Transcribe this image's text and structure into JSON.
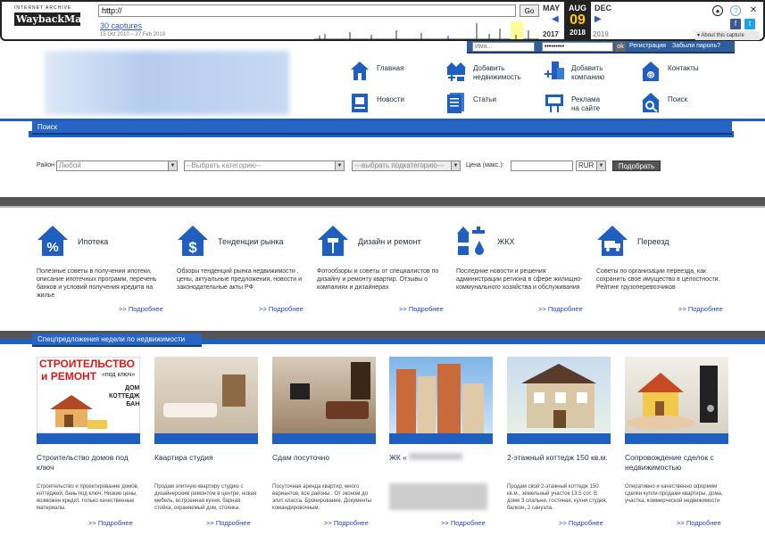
{
  "wayback": {
    "logo_top": "INTERNET ARCHIVE",
    "logo_main": "WaybackMachine",
    "url_value": "http://",
    "go_label": "Go",
    "captures_link": "30 captures",
    "range": "15 Oct 2010 – 27 Feb 2019",
    "prev_month": "MAY",
    "cur_month": "AUG",
    "next_month": "DEC",
    "cur_day": "09",
    "prev_year": "2017",
    "cur_year": "2018",
    "next_year": "2019",
    "about_label": "About this capture",
    "icons": [
      "user-icon",
      "help-icon",
      "facebook-icon",
      "twitter-icon"
    ]
  },
  "login": {
    "name_placeholder": "Имя...",
    "password_value": "•••••••••",
    "ok_label": "ok",
    "register": "Регистрация",
    "forgot": "Забыли пароль?"
  },
  "nav": [
    {
      "label": "Главная",
      "icon": "home-icon"
    },
    {
      "label": "Добавить\nнедвижимость",
      "icon": "add-property-icon"
    },
    {
      "label": "Добавить\nкомпанию",
      "icon": "add-company-icon"
    },
    {
      "label": "Контакты",
      "icon": "contacts-icon"
    },
    {
      "label": "Новости",
      "icon": "news-icon"
    },
    {
      "label": "Статьи",
      "icon": "articles-icon"
    },
    {
      "label": "Реклама\nна сайте",
      "icon": "advertising-icon"
    },
    {
      "label": "Поиск",
      "icon": "search-icon"
    }
  ],
  "search": {
    "tab": "Поиск",
    "district_label": "Район",
    "district_value": "Любой",
    "category_value": "--Выбрать категорию--",
    "subcategory_value": "---выбрать подкатегорию---",
    "price_label": "Цена (макс.):",
    "currency": "RUR",
    "submit": "Подобрать"
  },
  "categories": [
    {
      "title": "Ипотека",
      "icon": "mortgage-percent-icon",
      "desc": "Полезные советы в получении ипотеки, описание ипотечных программ, перечень банков и условий получения кредита на жилье",
      "more": ">> Подробнее"
    },
    {
      "title": "Тенденции рынка",
      "icon": "market-dollar-icon",
      "desc": "Обзоры тенденций рынка недвижимости , цены, актуальные предложения, новости и законодательные акты РФ",
      "more": ">> Подробнее"
    },
    {
      "title": "Дизайн и ремонт",
      "icon": "paint-roller-icon",
      "desc": "Фотообзоры и советы от специалистов по дизайну и ремонту квартир. Отзывы о компаниях и дизайнерах",
      "more": ">> Подробнее"
    },
    {
      "title": "ЖКХ",
      "icon": "utilities-icon",
      "desc": "Последние новости и решения администрации региона в сфере жилищно-коммунального хозяйства и обслуживания",
      "more": ">> Подробнее"
    },
    {
      "title": "Переезд",
      "icon": "moving-truck-icon",
      "desc": "Советы по организации переезда, как сохранить свое имущество в целостности. Рейтинг грузоперевозчиков",
      "more": ">> Подробнее"
    }
  ],
  "offers": {
    "tab": "Спецпредложения недели по недвижимости",
    "items": [
      {
        "title": "Строительство домов под ключ",
        "desc": "Строительство и проектирование домов, коттеджей, бань под ключ. Низкие цены, возможен кредит, только качественные материалы.",
        "more": ">> Подробнее",
        "ad_line1": "СТРОИТЕЛЬСТВО",
        "ad_line2": "и РЕМОНТ",
        "ad_line3": "«под ключ»",
        "ad_line4": "ДОМА\nКОТТЕДЖИ\nБАНИ"
      },
      {
        "title": "Квартира студия",
        "desc": "Продам элитную квартиру студию с дизайнерским ремонтом в центре, новая мебель, встроенная кухня, барная стойка, охраняемый дом, стоянка.",
        "more": ">> Подробнее"
      },
      {
        "title": "Сдам посуточно",
        "desc": "Посуточная аренда квартир, много вариантов, все районы . От эконом до элит класса. Бронирование. Документы командировочным.",
        "more": ">> Подробнее"
      },
      {
        "title": "ЖК «",
        "desc": "",
        "more": ">> Подробнее"
      },
      {
        "title": "2-этажный коттедж 150 кв.м.",
        "desc": "Продам свой 2-этажный коттедж 150 кв.м., земельный участок 13.5 сот. В доме 3 спальни, гостиная, кухня студия, балкон, 2 санузла.",
        "more": ">> Подробнее"
      },
      {
        "title": "Сопровождение сделок с недвижимостью",
        "desc": "Оперативно и качественно оформим сделки купли-продажи квартиры, дома, участка, коммерческой недвижимости",
        "more": ">> Подробнее"
      }
    ]
  },
  "colors": {
    "accent": "#1f5fbf",
    "dark_bar": "#555555",
    "link": "#2244cc"
  }
}
